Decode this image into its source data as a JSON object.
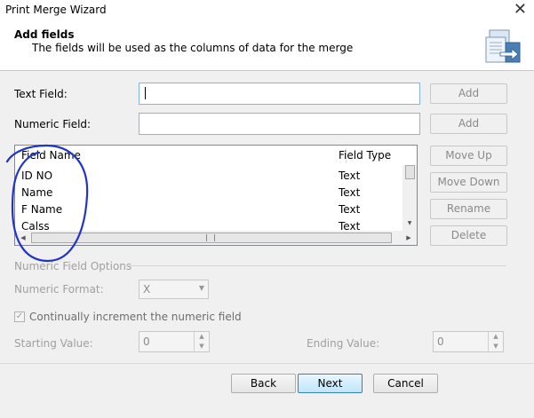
{
  "window": {
    "title": "Print Merge Wizard"
  },
  "header": {
    "title": "Add fields",
    "subtitle": "The fields will be used as the columns of data for the merge"
  },
  "text_field": {
    "label": "Text Field:",
    "value": "",
    "add_label": "Add"
  },
  "numeric_field": {
    "label": "Numeric Field:",
    "value": "",
    "add_label": "Add"
  },
  "field_list": {
    "columns": [
      "Field Name",
      "Field Type"
    ],
    "rows": [
      {
        "name": "ID NO",
        "type": "Text"
      },
      {
        "name": "Name",
        "type": "Text"
      },
      {
        "name": "F Name",
        "type": "Text"
      },
      {
        "name": "Calss",
        "type": "Text"
      }
    ]
  },
  "side_buttons": {
    "move_up": "Move Up",
    "move_down": "Move Down",
    "rename": "Rename",
    "delete": "Delete"
  },
  "numeric_options": {
    "group_label": "Numeric Field Options",
    "format_label": "Numeric Format:",
    "format_value": "X",
    "increment_label": "Continually increment the numeric field",
    "increment_checked": true,
    "starting_label": "Starting Value:",
    "starting_value": "0",
    "ending_label": "Ending Value:",
    "ending_value": "0"
  },
  "footer": {
    "back": "Back",
    "next": "Next",
    "cancel": "Cancel"
  },
  "colors": {
    "annotation": "#2233cc",
    "focus_border": "#7eb4ea",
    "disabled_text": "#a0a0a0"
  }
}
